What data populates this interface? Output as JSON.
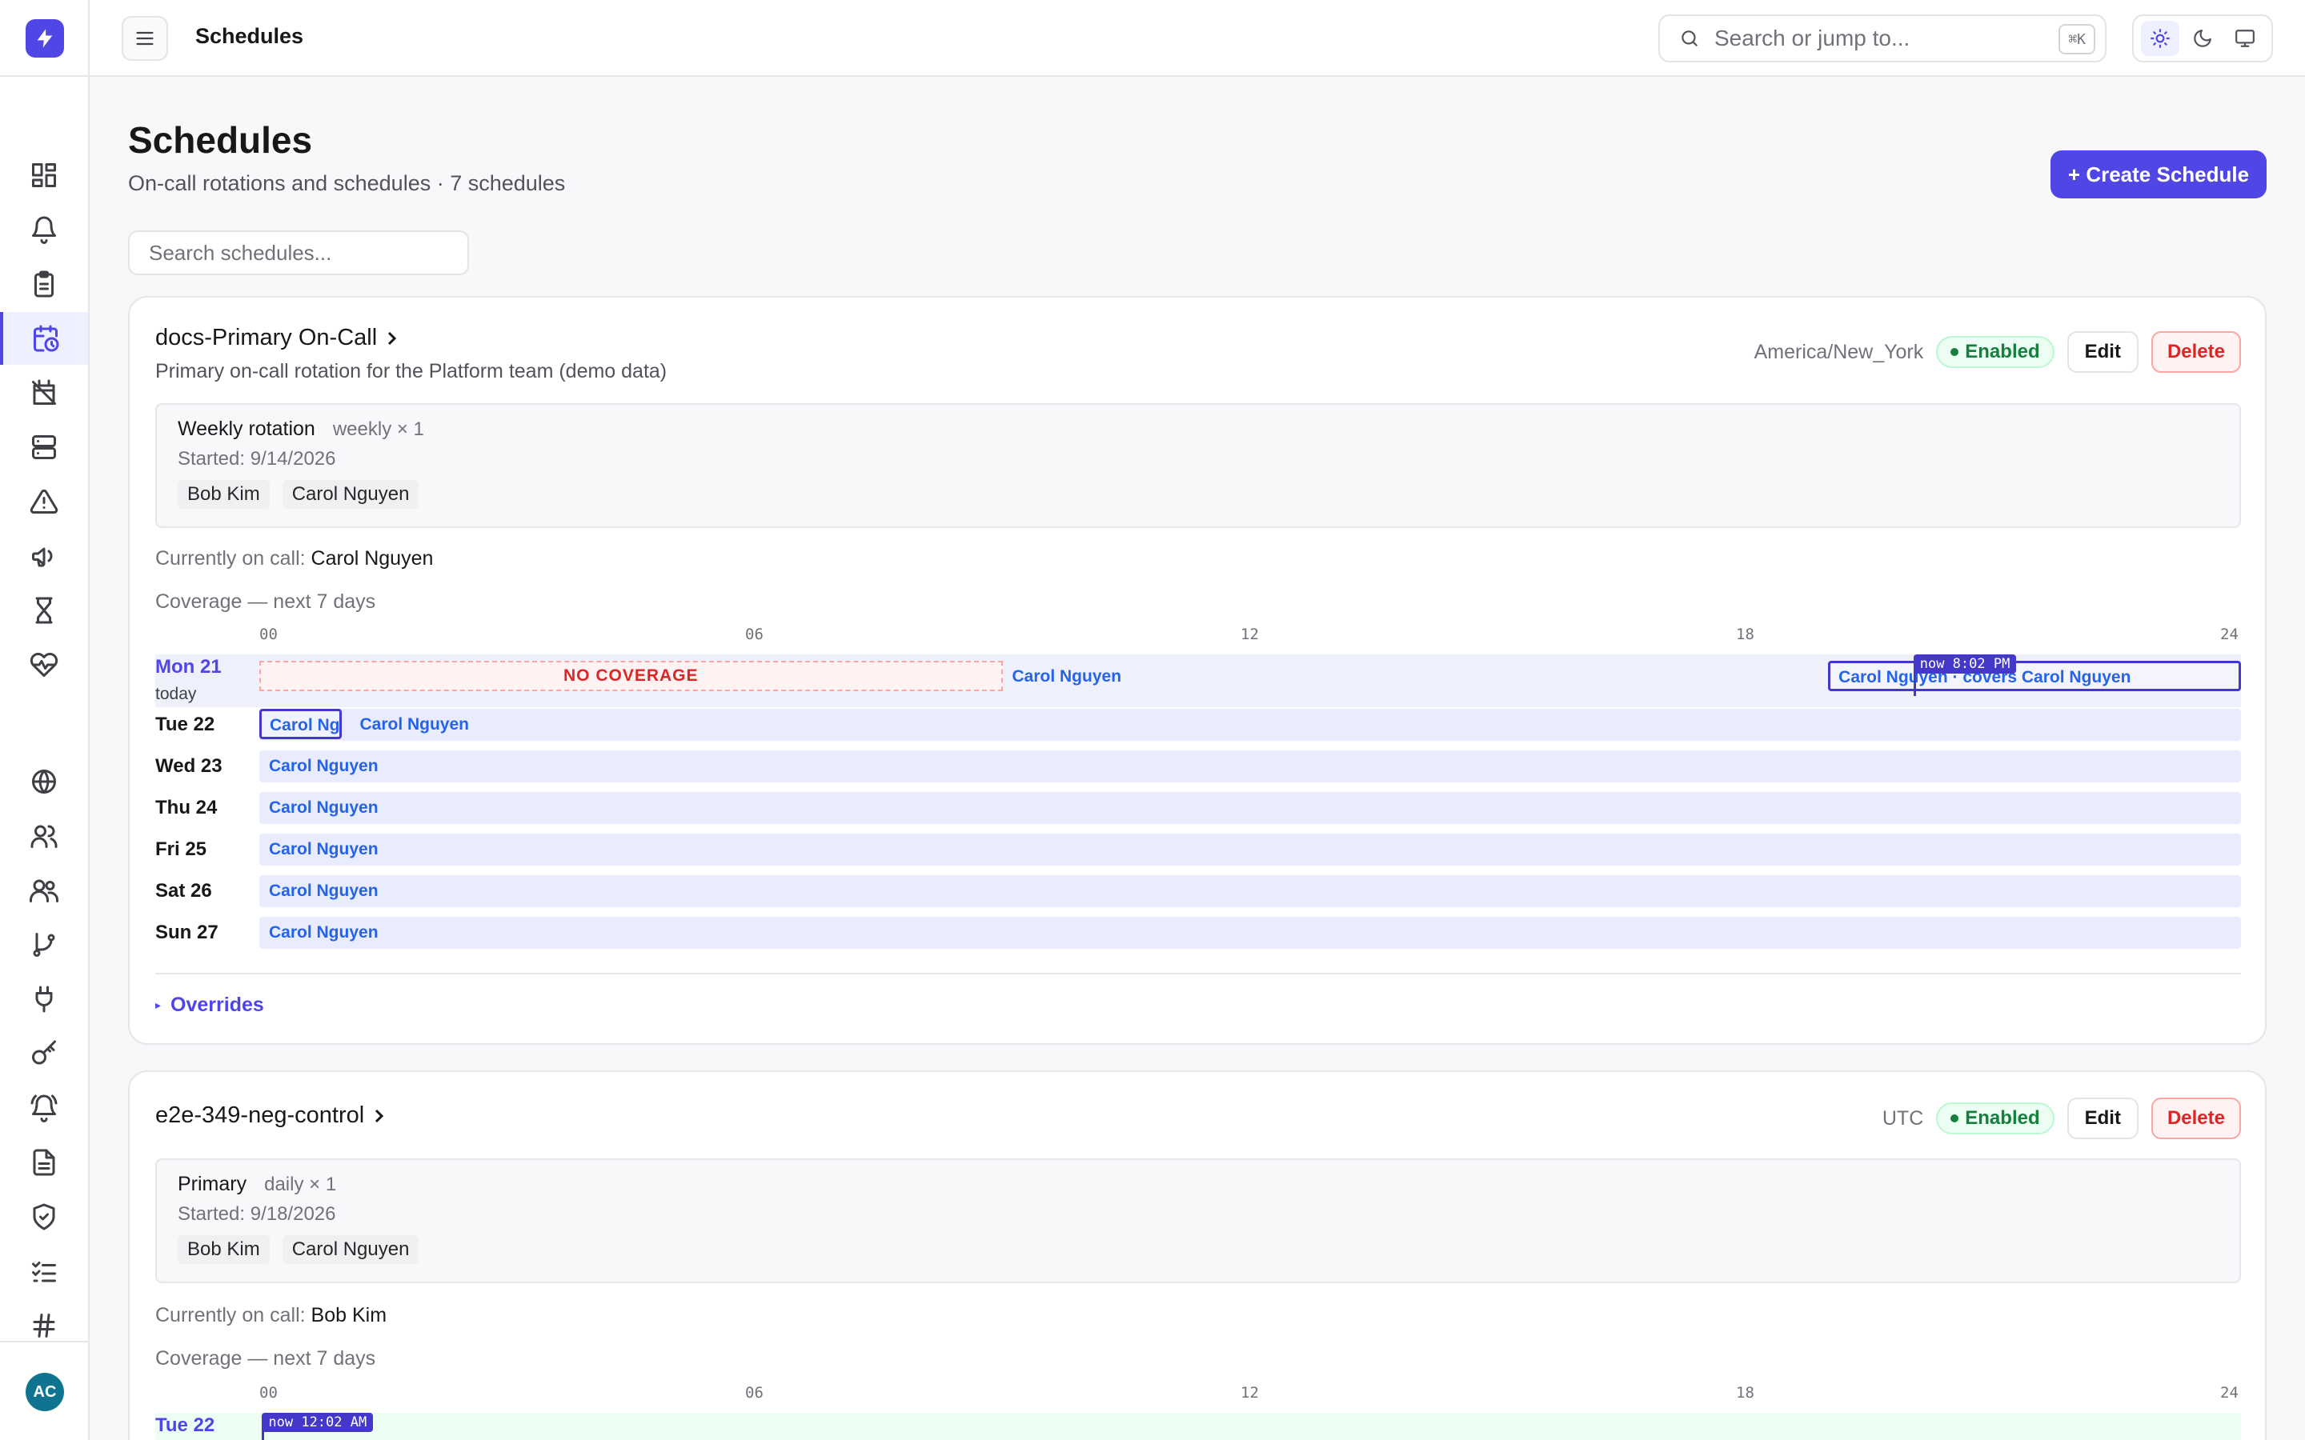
{
  "app": {
    "header_title": "Schedules",
    "search_placeholder": "Search or jump to...",
    "search_shortcut": "⌘K",
    "user_initials": "AC",
    "accent": "#4f46e5"
  },
  "page": {
    "title": "Schedules",
    "subtitle": "On-call rotations and schedules · 7 schedules",
    "create_label": "+ Create Schedule",
    "filter_placeholder": "Search schedules..."
  },
  "hour_ticks": [
    "00",
    "06",
    "12",
    "18",
    "24"
  ],
  "schedules": [
    {
      "name": "docs-Primary On-Call",
      "description": "Primary on-call rotation for the Platform team (demo data)",
      "timezone": "America/New_York",
      "status": "Enabled",
      "edit_label": "Edit",
      "delete_label": "Delete",
      "rotation": {
        "name": "Weekly rotation",
        "kind": "weekly × 1",
        "started": "Started: 9/14/2026",
        "members": [
          "Bob Kim",
          "Carol Nguyen"
        ]
      },
      "oncall_label": "Currently on call: ",
      "oncall_name": "Carol Nguyen",
      "coverage_label": "Coverage — next 7 days",
      "overrides_label": "Overrides",
      "days": [
        {
          "label": "Mon 21",
          "today": true,
          "today_note": "today",
          "gap": {
            "start": 0,
            "end": 9,
            "label": "NO COVERAGE"
          },
          "shifts": [
            {
              "start": 9,
              "end": 24,
              "label": "Carol Nguyen"
            }
          ],
          "override": {
            "start": 19,
            "end": 24,
            "label": "Carol Nguyen · covers Carol Nguyen"
          },
          "now": {
            "hour": 20.033,
            "label": "now 8:02 PM"
          }
        },
        {
          "label": "Tue 22",
          "shifts": [
            {
              "start": 1.1,
              "end": 24,
              "label": "Carol Nguyen"
            }
          ],
          "override": {
            "start": 0,
            "end": 1,
            "label": "Carol Nguyen"
          }
        },
        {
          "label": "Wed 23",
          "shifts": [
            {
              "start": 0,
              "end": 24,
              "label": "Carol Nguyen"
            }
          ]
        },
        {
          "label": "Thu 24",
          "shifts": [
            {
              "start": 0,
              "end": 24,
              "label": "Carol Nguyen"
            }
          ]
        },
        {
          "label": "Fri 25",
          "shifts": [
            {
              "start": 0,
              "end": 24,
              "label": "Carol Nguyen"
            }
          ]
        },
        {
          "label": "Sat 26",
          "shifts": [
            {
              "start": 0,
              "end": 24,
              "label": "Carol Nguyen"
            }
          ]
        },
        {
          "label": "Sun 27",
          "shifts": [
            {
              "start": 0,
              "end": 24,
              "label": "Carol Nguyen"
            }
          ]
        }
      ]
    },
    {
      "name": "e2e-349-neg-control",
      "description": "",
      "timezone": "UTC",
      "status": "Enabled",
      "edit_label": "Edit",
      "delete_label": "Delete",
      "rotation": {
        "name": "Primary",
        "kind": "daily × 1",
        "started": "Started: 9/18/2026",
        "members": [
          "Bob Kim",
          "Carol Nguyen"
        ]
      },
      "oncall_label": "Currently on call: ",
      "oncall_name": "Bob Kim",
      "coverage_label": "Coverage — next 7 days",
      "days": [
        {
          "label": "Tue 22",
          "today": true,
          "now": {
            "hour": 0.033,
            "label": "now 12:02 AM"
          }
        }
      ]
    }
  ]
}
